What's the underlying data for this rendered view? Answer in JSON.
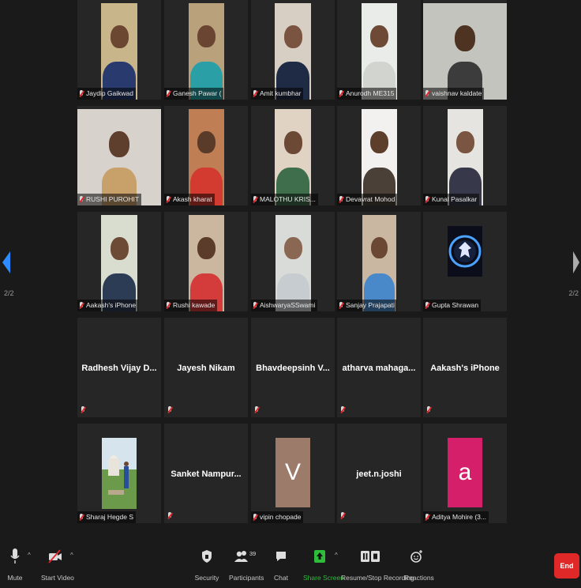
{
  "pagination": {
    "left": "2/2",
    "right": "2/2"
  },
  "participants": [
    {
      "name": "Jaydip Gaikwad",
      "type": "video"
    },
    {
      "name": "Ganesh Pawar (",
      "type": "video"
    },
    {
      "name": "Amit kumbhar",
      "type": "video"
    },
    {
      "name": "Anurodh ME315",
      "type": "video"
    },
    {
      "name": "vaishnav kaldate",
      "type": "video"
    },
    {
      "name": "RUSHI PUROHIT",
      "type": "video"
    },
    {
      "name": "Akash kharat",
      "type": "video"
    },
    {
      "name": "MALOTHU KRIS...",
      "type": "video"
    },
    {
      "name": "Devavrat Mohod",
      "type": "video"
    },
    {
      "name": "Kunal Pasalkar",
      "type": "video"
    },
    {
      "name": "Aakash's iPhone",
      "type": "video"
    },
    {
      "name": "Rushi kawade",
      "type": "video"
    },
    {
      "name": "AishwaryaSSwami",
      "type": "video"
    },
    {
      "name": "Sanjay Prajapati",
      "type": "video"
    },
    {
      "name": "Gupta Shrawan",
      "type": "logo"
    },
    {
      "name": "Radhesh Vijay D...",
      "type": "name"
    },
    {
      "name": "Jayesh Nikam",
      "type": "name"
    },
    {
      "name": "Bhavdeepsinh V...",
      "type": "name"
    },
    {
      "name": "atharva mahaga...",
      "type": "name"
    },
    {
      "name": "Aakash's iPhone",
      "type": "name"
    },
    {
      "name": "Sharaj Hegde S",
      "type": "photo"
    },
    {
      "name": "Sanket Nampur...",
      "type": "name"
    },
    {
      "name": "vipin chopade",
      "type": "avatar",
      "letter": "V",
      "color": "#9c7b6a"
    },
    {
      "name": "jeet.n.joshi",
      "type": "name"
    },
    {
      "name": "Aditya Mohire (3...",
      "type": "avatar",
      "letter": "a",
      "color": "#d61f6a"
    }
  ],
  "toolbar": {
    "mute": "Mute",
    "start_video": "Start Video",
    "security": "Security",
    "participants": "Participants",
    "participants_count": "39",
    "chat": "Chat",
    "share_screen": "Share Screen",
    "recording": "Resume/Stop Recording",
    "reactions": "Reactions",
    "end": "End"
  },
  "colors": {
    "share_green": "#2dbd3a",
    "end_red": "#e02828",
    "nav_blue": "#2d8cff"
  }
}
